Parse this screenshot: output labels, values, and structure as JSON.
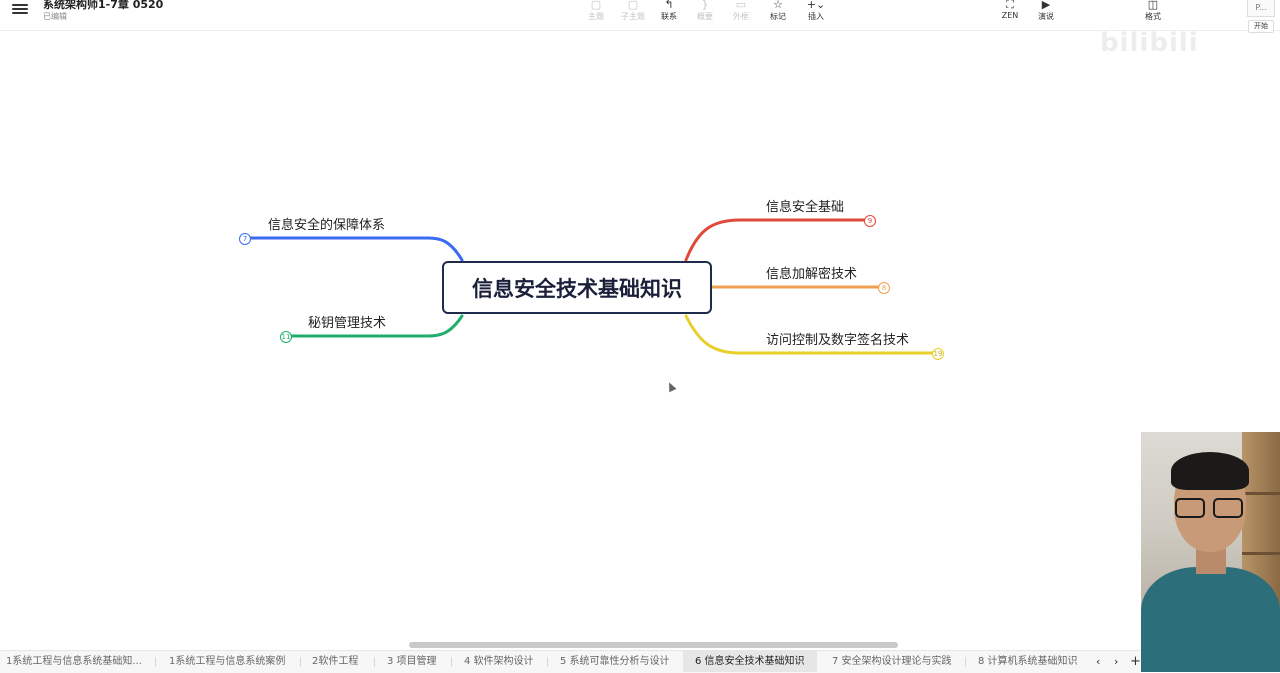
{
  "header": {
    "title": "系统架构师1-7章 0520",
    "status": "已编辑"
  },
  "toolbar": {
    "topic": "主题",
    "subtopic": "子主题",
    "relation": "联系",
    "summary": "概要",
    "boundary": "外框",
    "marker": "标记",
    "insert": "插入",
    "zen": "ZEN",
    "present": "演说",
    "format": "格式"
  },
  "corner": {
    "preview": "P...",
    "start": "开始"
  },
  "watermark": "bilibili",
  "mindmap": {
    "root": "信息安全技术基础知识",
    "left": [
      {
        "label": "信息安全的保障体系",
        "count": "7",
        "color": "#3b6bf0"
      },
      {
        "label": "秘钥管理技术",
        "count": "11",
        "color": "#1fae6b"
      }
    ],
    "right": [
      {
        "label": "信息安全基础",
        "count": "9",
        "color": "#e04a3a"
      },
      {
        "label": "信息加解密技术",
        "count": "8",
        "color": "#f0a050"
      },
      {
        "label": "访问控制及数字签名技术",
        "count": "19",
        "color": "#e8cf2a"
      }
    ]
  },
  "sheets": {
    "tabs": [
      "1系统工程与信息系统基础知...",
      "1系统工程与信息系统案例",
      "2软件工程",
      "3 项目管理",
      "4 软件架构设计",
      "5 系统可靠性分析与设计",
      "6 信息安全技术基础知识",
      "7 安全架构设计理论与实践",
      "8 计算机系统基础知识"
    ],
    "active_index": 6,
    "prev": "‹",
    "next": "›",
    "add": "+"
  }
}
